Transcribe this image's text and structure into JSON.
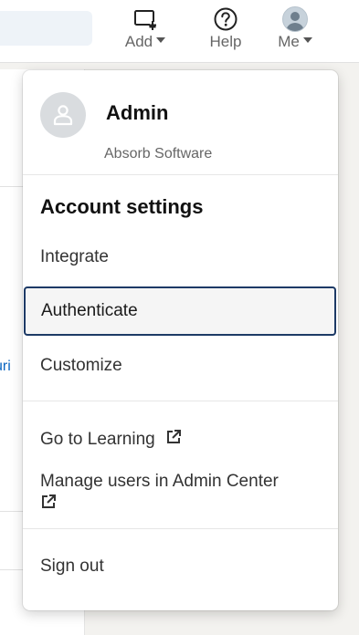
{
  "nav": {
    "add_label": "Add",
    "help_label": "Help",
    "me_label": "Me"
  },
  "background": {
    "link_fragment": "curi"
  },
  "menu": {
    "user_name": "Admin",
    "organization": "Absorb Software",
    "section_title": "Account settings",
    "items": [
      {
        "label": "Integrate"
      },
      {
        "label": "Authenticate",
        "selected": true
      },
      {
        "label": "Customize"
      }
    ],
    "links": [
      {
        "label": "Go to Learning",
        "icon": "external-link-icon"
      },
      {
        "label": "Manage users in Admin Center",
        "icon": "external-link-icon"
      }
    ],
    "sign_out": "Sign out"
  },
  "colors": {
    "selected_border": "#1d3a66",
    "link_blue": "#0a66c2"
  }
}
